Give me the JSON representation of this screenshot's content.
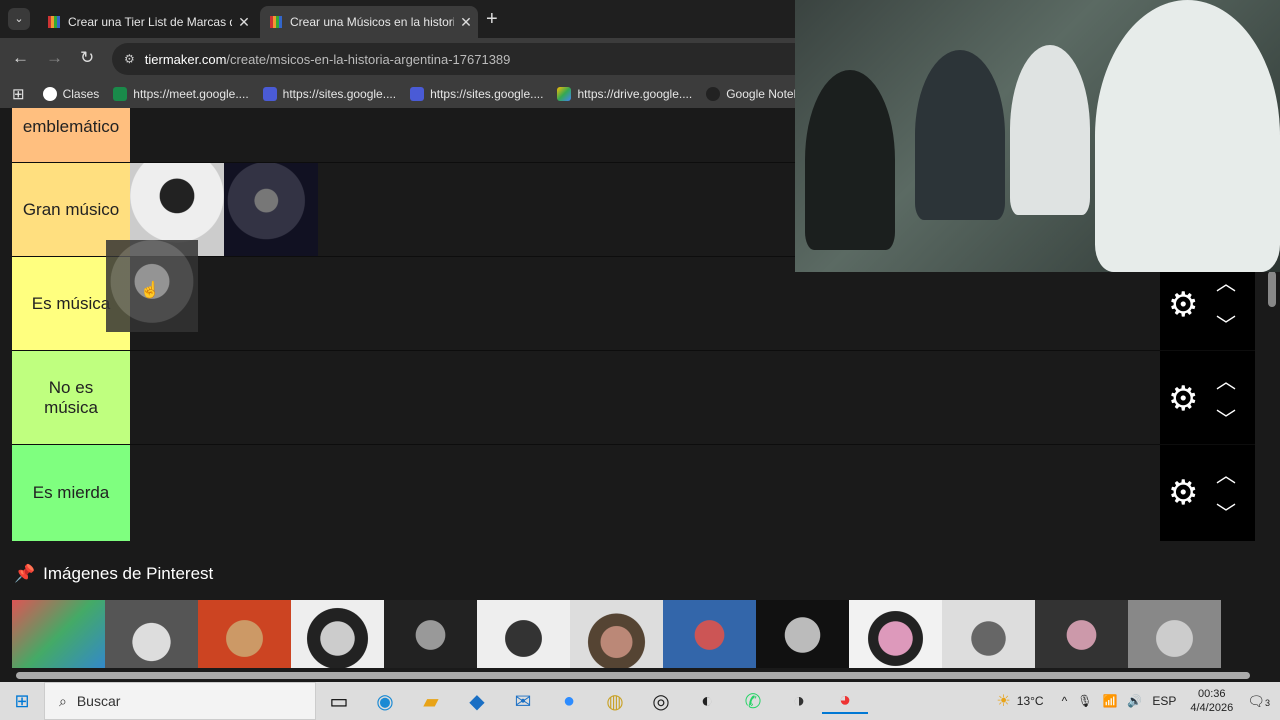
{
  "browser": {
    "tabs": [
      {
        "title": "Crear una Tier List de Marcas d",
        "active": false
      },
      {
        "title": "Crear una Músicos en la histori",
        "active": true
      }
    ],
    "url_host": "tiermaker.com",
    "url_path": "/create/msicos-en-la-historia-argentina-17671389",
    "bookmarks": [
      "Clases",
      "https://meet.google....",
      "https://sites.google....",
      "https://sites.google....",
      "https://drive.google....",
      "Google Notebo"
    ]
  },
  "tiers": [
    {
      "label": "emblemático",
      "color": "#ffbf7f"
    },
    {
      "label": "Gran músico",
      "color": "#ffdf7f"
    },
    {
      "label": "Es música",
      "color": "#ffff7f"
    },
    {
      "label": "No es música",
      "color": "#bfff7f"
    },
    {
      "label": "Es mierda",
      "color": "#7fff7f"
    }
  ],
  "pool": {
    "title": "Imágenes de Pinterest",
    "count": 13
  },
  "taskbar": {
    "search_placeholder": "Buscar",
    "weather": "13°C",
    "lang": "ESP",
    "time": "00:36",
    "date": "4/4/2026",
    "notifications": "3"
  }
}
